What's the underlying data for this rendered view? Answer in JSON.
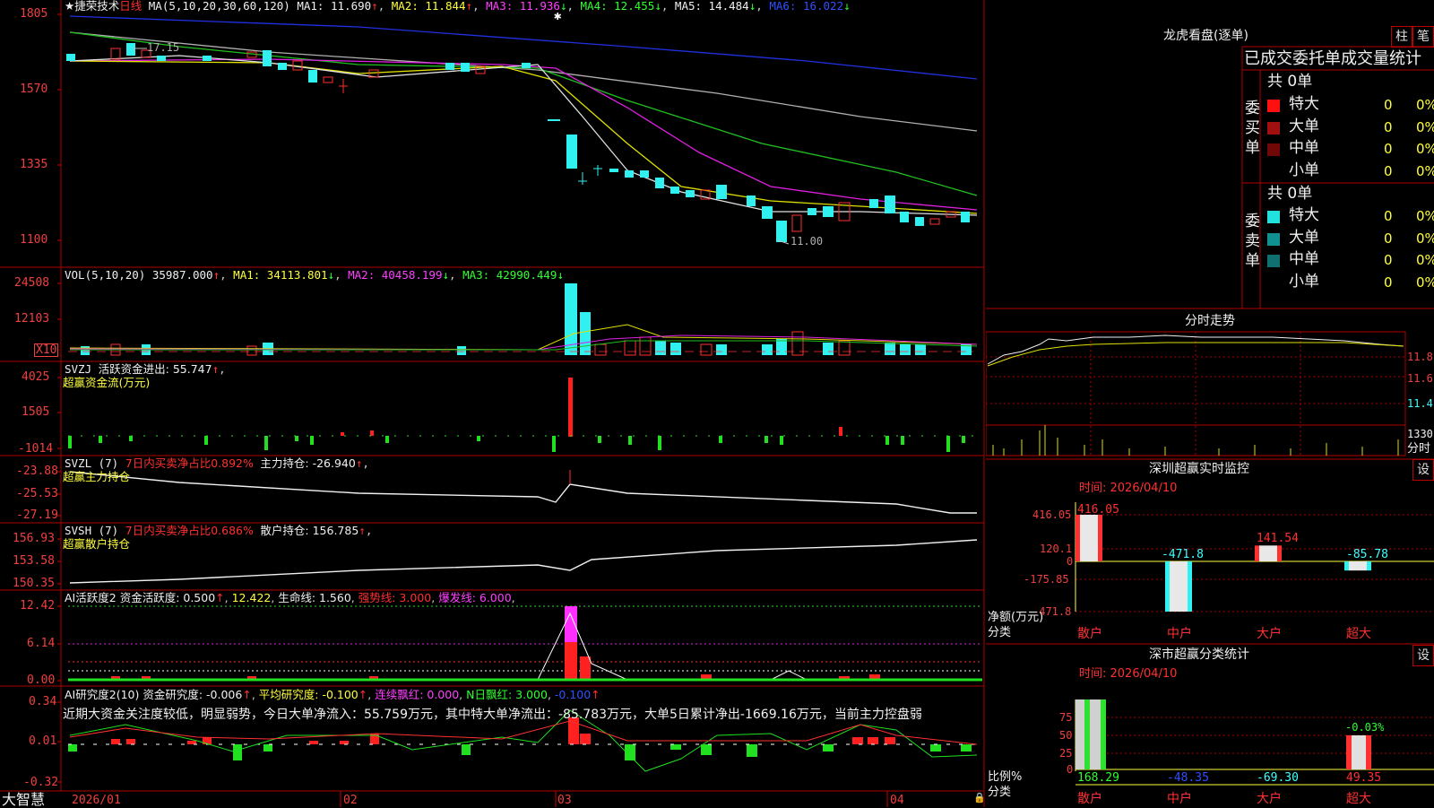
{
  "stock": {
    "name": "捷荣技术",
    "period": "日线"
  },
  "main_header": {
    "ma_params": "MA(5,10,20,30,60,120)",
    "ma1": "MA1: 11.690",
    "ma2": "MA2: 11.844",
    "ma3": "MA3: 11.936",
    "ma4": "MA4: 12.455",
    "ma5": "MA5: 14.484",
    "ma6": "MA6: 16.022"
  },
  "main_axis": [
    "1805",
    "1570",
    "1335",
    "1100"
  ],
  "price_annotations": {
    "high": "17.15",
    "low": "11.00"
  },
  "vol_header": {
    "label": "VOL(5,10,20)",
    "value": "35987.000",
    "ma1": "MA1: 34113.801",
    "ma2": "MA2: 40458.199",
    "ma3": "MA3: 42990.449"
  },
  "vol_axis": [
    "24508",
    "12103"
  ],
  "vol_unit": "X10",
  "svzj_header": {
    "label": "SVZJ",
    "desc": "活跃资金进出: 55.747",
    "sub": "超赢资金流(万元)"
  },
  "svzj_axis": [
    "4025",
    "1505",
    "-1014"
  ],
  "svzl_header": {
    "label": "SVZL (7)",
    "ratio": "7日内买卖净占比0.892%",
    "hold": "主力持仓: -26.940",
    "sub": "超赢主力持仓"
  },
  "svzl_axis": [
    "-23.88",
    "-25.53",
    "-27.19"
  ],
  "svsh_header": {
    "label": "SVSH (7)",
    "ratio": "7日内买卖净占比0.686%",
    "hold": "散户持仓: 156.785",
    "sub": "超赢散户持仓"
  },
  "svsh_axis": [
    "156.93",
    "153.58",
    "150.35"
  ],
  "ai_active": {
    "label": "AI活跃度2",
    "v1": "资金活跃度: 0.500",
    "v2": "12.422",
    "v3": "生命线: 1.560",
    "v4": "强势线: 3.000",
    "v5": "爆发线: 6.000"
  },
  "ai_active_axis": [
    "12.42",
    "6.14",
    "0.00"
  ],
  "ai_research": {
    "label": "AI研究度2(10)",
    "v1": "资金研究度: -0.006",
    "v2": "平均研究度: -0.100",
    "v3": "连续飘红: 0.000",
    "v4": "N日飘红: 3.000",
    "v5": "-0.100"
  },
  "ai_research_axis": [
    "0.34",
    "0.01",
    "-0.32"
  ],
  "ai_comment": "近期大资金关注度较低，明显弱势，今日大单净流入：55.759万元，其中特大单净流出：-85.783万元，大单5日累计净出-1669.16万元，当前主力控盘弱",
  "date_axis": [
    "2026/01",
    "02",
    "03",
    "04"
  ],
  "brand": "大智慧",
  "dragon_tiger": {
    "title": "龙虎看盘(逐单)",
    "tabs": [
      "柱",
      "笔"
    ],
    "subtitle": "已成交委托单成交量统计",
    "buy": {
      "label": "委买单",
      "total": "共 0单",
      "rows": [
        {
          "name": "特大",
          "count": "0",
          "pct": "0%",
          "color": "#ff1010"
        },
        {
          "name": "大单",
          "count": "0",
          "pct": "0%",
          "color": "#a01010"
        },
        {
          "name": "中单",
          "count": "0",
          "pct": "0%",
          "color": "#700808"
        },
        {
          "name": "小单",
          "count": "0",
          "pct": "0%",
          "color": ""
        }
      ]
    },
    "sell": {
      "label": "委卖单",
      "total": "共 0单",
      "rows": [
        {
          "name": "特大",
          "count": "0",
          "pct": "0%",
          "color": "#20e0e0"
        },
        {
          "name": "大单",
          "count": "0",
          "pct": "0%",
          "color": "#109090"
        },
        {
          "name": "中单",
          "count": "0",
          "pct": "0%",
          "color": "#107070"
        },
        {
          "name": "小单",
          "count": "0",
          "pct": "0%",
          "color": ""
        }
      ]
    }
  },
  "intraday": {
    "title": "分时走势",
    "axis": [
      "11.81",
      "11.61",
      "11.41"
    ],
    "vol_axis": "1330",
    "vol_unit": "分时"
  },
  "monitor": {
    "title": "深圳超赢实时监控",
    "settings": "设",
    "date": "时间: 2026/04/10",
    "axis": [
      "416.05",
      "120.1",
      "0",
      "-175.85",
      "-471.8"
    ],
    "ylabel": "净额(万元)",
    "xlabel": "分类",
    "categories": [
      "散户",
      "中户",
      "大户",
      "超大"
    ],
    "values": [
      416.05,
      -471.8,
      141.54,
      -85.78
    ],
    "value_labels": [
      "416.05",
      "-471.8",
      "141.54",
      "-85.78"
    ]
  },
  "classify": {
    "title": "深市超赢分类统计",
    "settings": "设",
    "date": "时间: 2026/04/10",
    "axis": [
      "75",
      "50",
      "25",
      "0"
    ],
    "ylabel": "比例%",
    "xlabel": "分类",
    "categories": [
      "散户",
      "中户",
      "大户",
      "超大"
    ],
    "values": [
      "168.29",
      "-48.35",
      "-69.30",
      "49.35"
    ],
    "top_label": "-0.03%"
  },
  "chart_data": [
    {
      "type": "line",
      "title": "捷荣技术 日线",
      "x": [
        "2026/01",
        "02",
        "03",
        "04"
      ],
      "series": [
        {
          "name": "MA1",
          "values": [
            11.69
          ]
        },
        {
          "name": "MA2",
          "values": [
            11.844
          ]
        },
        {
          "name": "MA3",
          "values": [
            11.936
          ]
        },
        {
          "name": "MA4",
          "values": [
            12.455
          ]
        },
        {
          "name": "MA5",
          "values": [
            14.484
          ]
        },
        {
          "name": "MA6",
          "values": [
            16.022
          ]
        }
      ],
      "ylim": [
        11.0,
        18.05
      ],
      "notes": "candlestick price history; high 17.15, low 11.00"
    },
    {
      "type": "bar",
      "title": "深圳超赢实时监控",
      "categories": [
        "散户",
        "中户",
        "大户",
        "超大"
      ],
      "values": [
        416.05,
        -471.8,
        141.54,
        -85.78
      ],
      "ylabel": "净额(万元)",
      "ylim": [
        -471.8,
        416.05
      ]
    },
    {
      "type": "bar",
      "title": "深市超赢分类统计",
      "categories": [
        "散户",
        "中户",
        "大户",
        "超大"
      ],
      "values": [
        168.29,
        -48.35,
        -69.3,
        49.35
      ],
      "ylabel": "比例%"
    }
  ]
}
